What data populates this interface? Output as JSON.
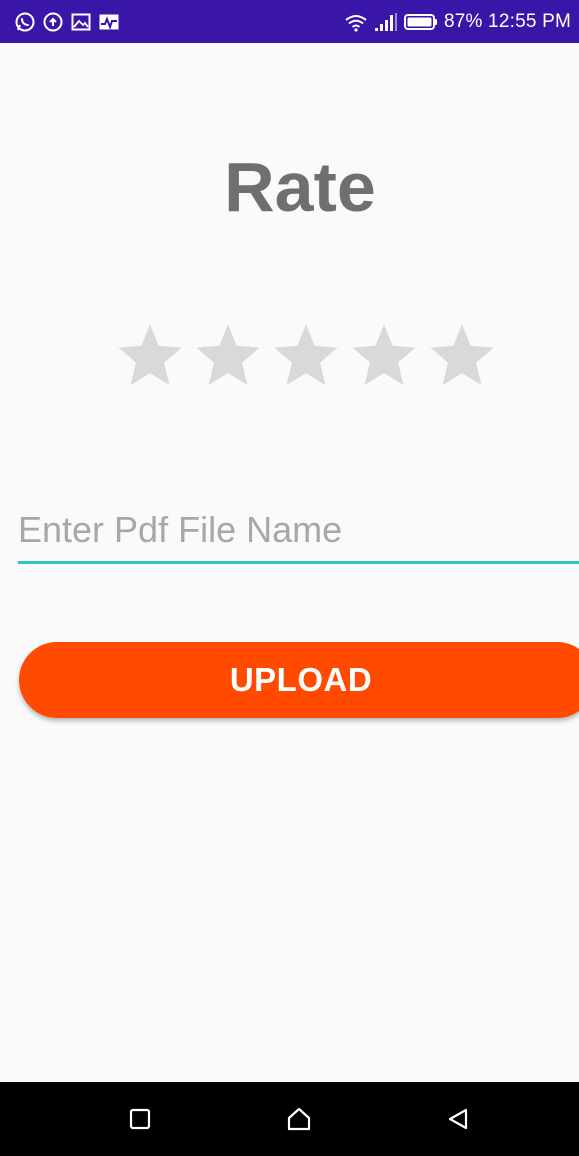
{
  "status_bar": {
    "notification_icons": [
      "whatsapp-icon",
      "cloud-upload-icon",
      "image-icon",
      "activity-icon"
    ],
    "right_text": "87% 12:55 PM",
    "system_icons": [
      "wifi-icon",
      "signal-icon",
      "battery-icon"
    ],
    "background_color": "#3a16a8"
  },
  "title": "Rate",
  "rating": {
    "max_stars": 5,
    "value": 0,
    "empty_color": "#d9d9d9"
  },
  "pdf_input": {
    "placeholder": "Enter Pdf File Name",
    "value": "",
    "underline_color": "#2bc8c0"
  },
  "upload_button": {
    "label": "UPLOAD",
    "color": "#ff4a00"
  },
  "nav_bar": {
    "buttons": [
      "recent-apps-icon",
      "home-icon",
      "back-icon"
    ]
  }
}
